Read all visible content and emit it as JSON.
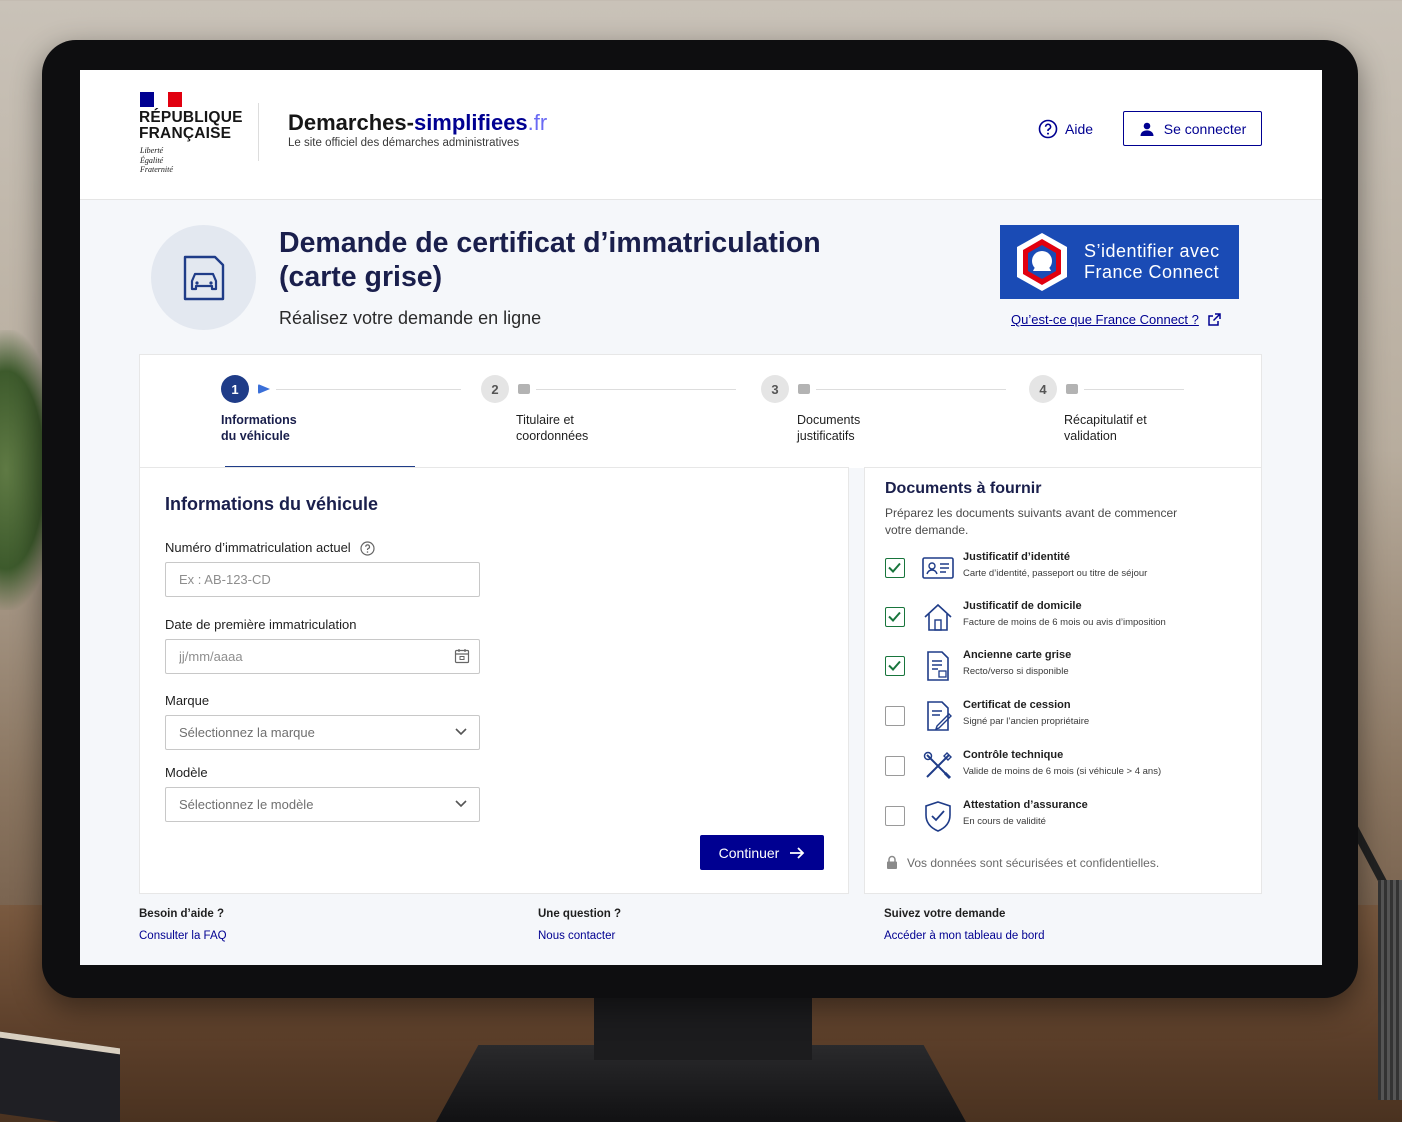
{
  "header": {
    "republique": [
      "RÉPUBLIQUE",
      "FRANÇAISE"
    ],
    "devise": [
      "Liberté",
      "Égalité",
      "Fraternité"
    ],
    "site_name_part1": "Demarches-",
    "site_name_part2": "simplifiees",
    "site_name_tld": ".fr",
    "tagline": "Le site officiel des démarches administratives",
    "help_label": "Aide",
    "login_label": "Se connecter"
  },
  "hero": {
    "title": "Demande de certificat d’immatriculation (carte grise)",
    "subtitle": "Réalisez votre demande en ligne",
    "franceconnect": {
      "line1": "S’identifier avec",
      "line2": "France Connect",
      "link": "Qu’est-ce que France Connect ?"
    }
  },
  "stepper": {
    "steps": [
      {
        "num": "1",
        "line1": "Informations",
        "line2": "du véhicule",
        "active": true
      },
      {
        "num": "2",
        "line1": "Titulaire et",
        "line2": "coordonnées",
        "active": false
      },
      {
        "num": "3",
        "line1": "Documents",
        "line2": "justificatifs",
        "active": false
      },
      {
        "num": "4",
        "line1": "Récapitulatif et",
        "line2": "validation",
        "active": false
      }
    ]
  },
  "form": {
    "title": "Informations du véhicule",
    "plate_label": "Numéro d’immatriculation actuel",
    "plate_placeholder": "Ex : AB-123-CD",
    "date_label": "Date de première immatriculation",
    "date_placeholder": "jj/mm/aaaa",
    "brand_label": "Marque",
    "brand_value": "Sélectionnez la marque",
    "model_label": "Modèle",
    "model_value": "Sélectionnez le modèle",
    "continue_label": "Continuer"
  },
  "documents": {
    "title": "Documents à fournir",
    "intro": "Préparez les documents suivants avant de commencer votre demande.",
    "items": [
      {
        "title": "Justificatif d’identité",
        "desc": "Carte d’identité, passeport ou titre de séjour",
        "checked": true,
        "icon": "id-card-icon"
      },
      {
        "title": "Justificatif de domicile",
        "desc": "Facture de moins de 6 mois ou avis d’imposition",
        "checked": true,
        "icon": "house-icon"
      },
      {
        "title": "Ancienne carte grise",
        "desc": "Recto/verso si disponible",
        "checked": true,
        "icon": "document-icon"
      },
      {
        "title": "Certificat de cession",
        "desc": "Signé par l’ancien propriétaire",
        "checked": false,
        "icon": "signed-document-icon"
      },
      {
        "title": "Contrôle technique",
        "desc": "Valide de moins de 6 mois (si véhicule > 4 ans)",
        "checked": false,
        "icon": "tools-icon"
      },
      {
        "title": "Attestation d’assurance",
        "desc": "En cours de validité",
        "checked": false,
        "icon": "shield-check-icon"
      }
    ],
    "secure_note": "Vos données sont sécurisées et confidentielles."
  },
  "footer": {
    "cols": [
      {
        "heading": "Besoin d’aide ?",
        "link": "Consulter la FAQ"
      },
      {
        "heading": "Une question ?",
        "link": "Nous contacter"
      },
      {
        "heading": "Suivez votre demande",
        "link": "Accéder à mon tableau de bord"
      }
    ]
  },
  "colors": {
    "primary": "#000091",
    "accent": "#1f3c88",
    "success": "#18753c",
    "franceconnect": "#1a4bb5"
  }
}
